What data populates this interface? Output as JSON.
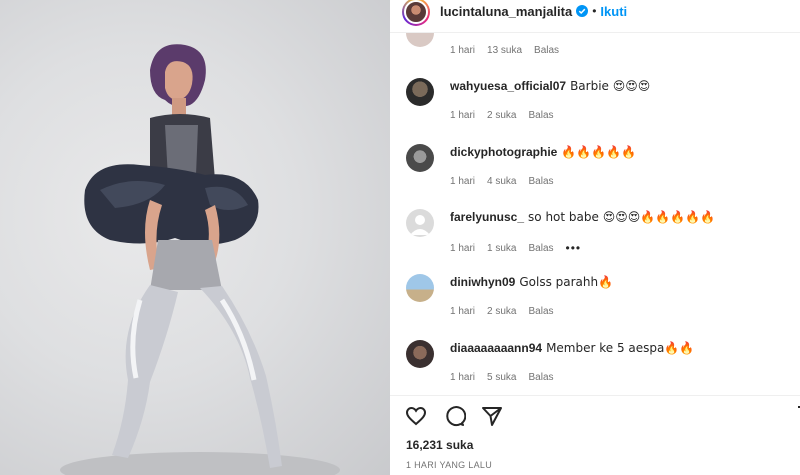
{
  "post": {
    "author": "lucintaluna_manjalita",
    "separator": "•",
    "follow_label": "Ikuti"
  },
  "partial_comment": {
    "time": "1 hari",
    "likes": "13 suka",
    "reply": "Balas"
  },
  "comments": [
    {
      "user": "wahyuesa_official07",
      "text": "Barbie 😍😍😍",
      "time": "1 hari",
      "likes": "2 suka",
      "reply": "Balas"
    },
    {
      "user": "dickyphotographie",
      "text": "🔥🔥🔥🔥🔥",
      "time": "1 hari",
      "likes": "4 suka",
      "reply": "Balas"
    },
    {
      "user": "farelyunusc_",
      "text": "so hot babe 😍😍😍🔥🔥🔥🔥🔥",
      "time": "1 hari",
      "likes": "1 suka",
      "reply": "Balas",
      "more": "•••"
    },
    {
      "user": "diniwhyn09",
      "text": "Golss parahh🔥",
      "time": "1 hari",
      "likes": "2 suka",
      "reply": "Balas"
    },
    {
      "user": "diaaaaaaaann94",
      "text": "Member ke 5 aespa🔥🔥",
      "time": "1 hari",
      "likes": "5 suka",
      "reply": "Balas"
    }
  ],
  "actions": {
    "likes": "16,231 suka",
    "posted": "1 HARI YANG LALU",
    "icons": [
      "heart-icon",
      "comment-icon",
      "share-icon",
      "bookmark-icon"
    ]
  },
  "colors": {
    "accent": "#0095f6",
    "muted": "#737373"
  }
}
